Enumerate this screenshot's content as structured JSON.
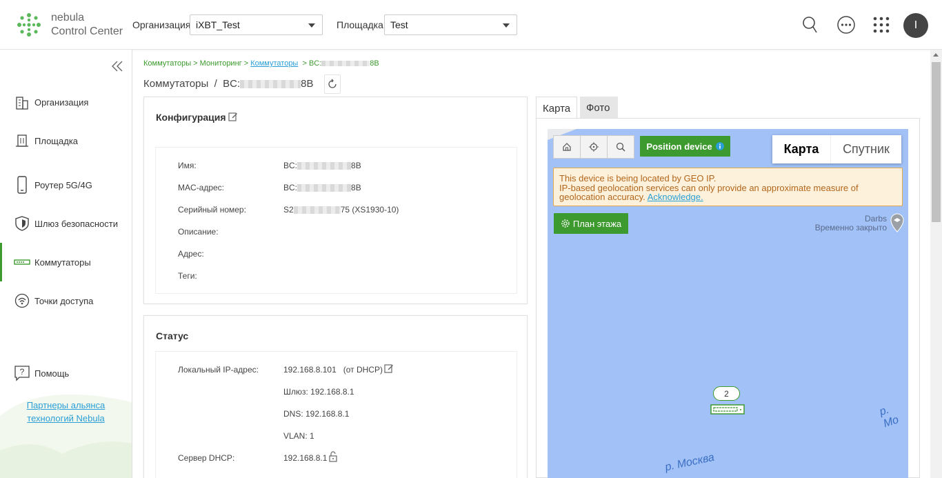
{
  "header": {
    "brand_line1": "nebula",
    "brand_line2": "Control Center",
    "org_label": "Организация:",
    "org_value": "iXBT_Test",
    "site_label": "Площадка:",
    "site_value": "Test",
    "avatar_letter": "I"
  },
  "sidebar": {
    "items": [
      {
        "label": "Организация",
        "icon": "building-icon"
      },
      {
        "label": "Площадка",
        "icon": "site-icon"
      },
      {
        "label": "Роутер 5G/4G",
        "icon": "mobile-router-icon"
      },
      {
        "label": "Шлюз безопасности",
        "icon": "shield-icon"
      },
      {
        "label": "Коммутаторы",
        "icon": "switch-icon"
      },
      {
        "label": "Точки доступа",
        "icon": "wifi-icon"
      }
    ],
    "help_label": "Помощь",
    "partners_line1": "Партнеры альянса",
    "partners_line2": "технологий Nebula"
  },
  "breadcrumb": {
    "part1": "Коммутаторы > Мониторинг >",
    "link": "Коммутаторы",
    "part3_prefix": "> BC:",
    "part3_suffix": "8B"
  },
  "page": {
    "title_prefix": "Коммутаторы  /  BC:",
    "title_suffix": "8B"
  },
  "config": {
    "title": "Конфигурация",
    "rows": [
      {
        "label": "Имя:",
        "value_prefix": "BC:",
        "value_suffix": "8B"
      },
      {
        "label": "MAC-адрес:",
        "value_prefix": "BC:",
        "value_suffix": "8B"
      },
      {
        "label": "Серийный номер:",
        "value_prefix": "S2",
        "value_suffix": "75 (XS1930-10)"
      },
      {
        "label": "Описание:"
      },
      {
        "label": "Адрес:"
      },
      {
        "label": "Теги:"
      }
    ]
  },
  "status": {
    "title": "Статус",
    "local_ip_label": "Локальный IP-адрес:",
    "local_ip_value": "192.168.8.101   (от DHCP)",
    "gateway": "Шлюз: 192.168.8.1",
    "dns": "DNS: 192.168.8.1",
    "vlan": "VLAN: 1",
    "dhcp_label": "Сервер DHCP:",
    "dhcp_value": "192.168.8.1"
  },
  "map_panel": {
    "tab_map": "Карта",
    "tab_photo": "Фото",
    "position_button": "Position device",
    "map_type_map": "Карта",
    "map_type_satellite": "Спутник",
    "warning_line1": "This device is being located by GEO IP.",
    "warning_line2": "IP-based geolocation services can only provide an approximate measure of",
    "warning_line3": "geolocation accuracy.",
    "warning_link": "Acknowledge.",
    "floor_plan_button": "План этажа",
    "poi_name": "Darbs",
    "poi_status": "Временно закрыто",
    "cluster_count": "2",
    "river_label_1": "р. Москва",
    "river_label_2": "р. Мо"
  },
  "colors": {
    "accent": "#3c9a2e",
    "link": "#2a9fd6",
    "map_water": "#a1c1f7",
    "warning_bg": "#fdf1dc"
  }
}
